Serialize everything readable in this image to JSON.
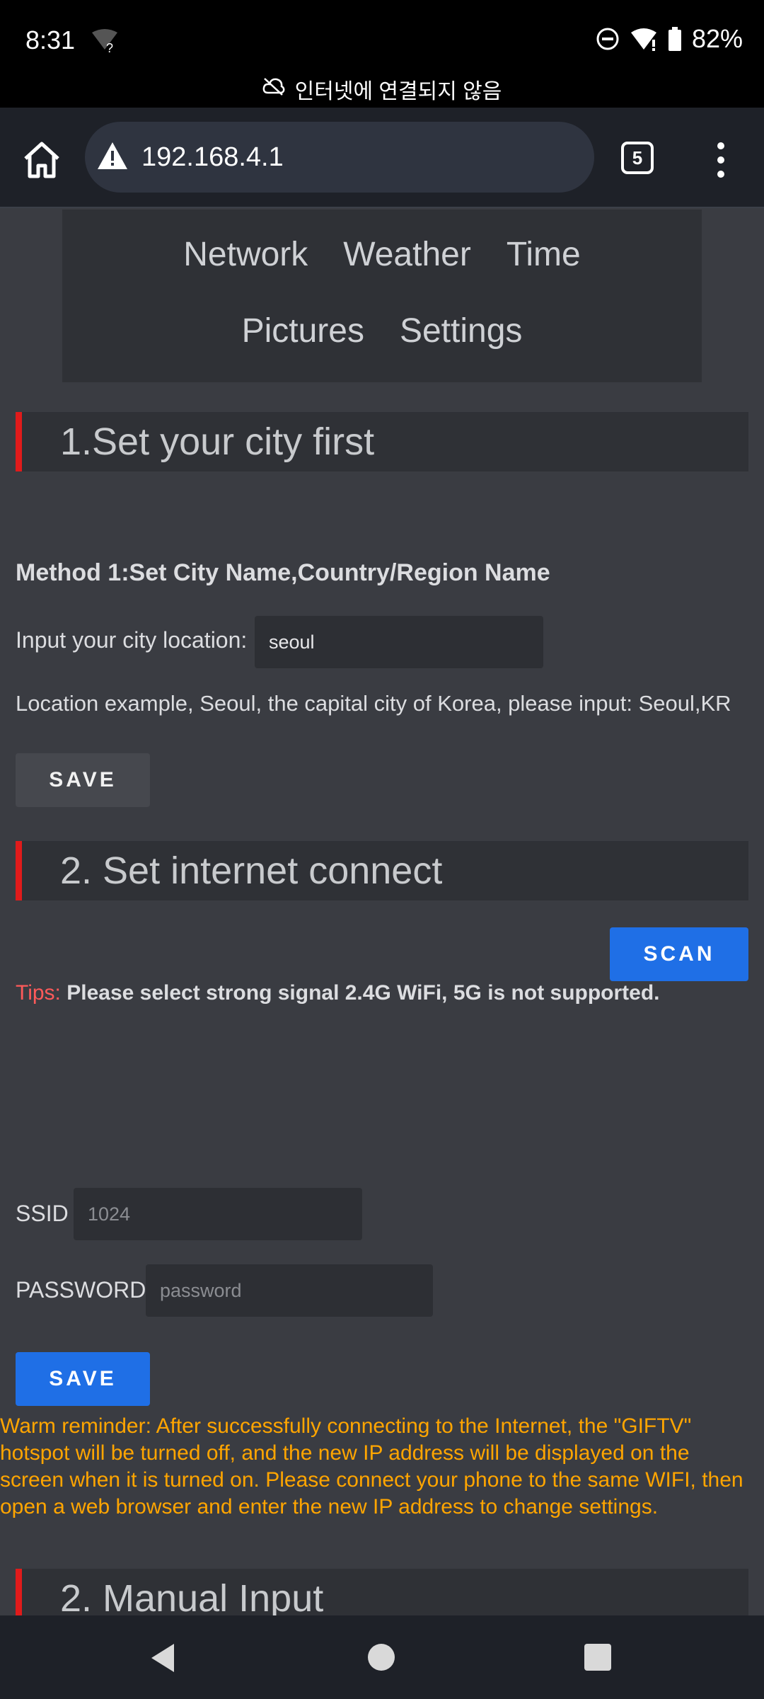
{
  "status_bar": {
    "time": "8:31",
    "battery": "82%",
    "offline_banner": "인터넷에 연결되지 않음"
  },
  "browser": {
    "url": "192.168.4.1",
    "tab_count": "5"
  },
  "nav": {
    "row1": [
      "Network",
      "Weather",
      "Time"
    ],
    "row2": [
      "Pictures",
      "Settings"
    ]
  },
  "section1": {
    "header": "1.Set your city first",
    "method_title": "Method 1:Set City Name,Country/Region Name",
    "city_label": "Input your city location:",
    "city_value": "seoul",
    "example": "Location example, Seoul, the capital city of Korea, please input: Seoul,KR",
    "save_label": "SAVE"
  },
  "section2": {
    "header": "2. Set internet connect",
    "scan_label": "SCAN",
    "tips_label": "Tips:",
    "tips_text": "Please select strong signal 2.4G WiFi, 5G is not supported.",
    "ssid_label": "SSID :",
    "ssid_placeholder": "1024",
    "password_label": "PASSWORD :",
    "password_placeholder": "password",
    "save_label": "SAVE",
    "warm_reminder": "Warm reminder: After successfully connecting to the Internet, the \"GIFTV\" hotspot will be turned off, and the new IP address will be displayed on the screen when it is turned on. Please connect your phone to the same WIFI, then open a web browser and enter the new IP address to change settings."
  },
  "section3": {
    "header": "2. Manual Input"
  },
  "colors": {
    "accent_red": "#e01b1b",
    "button_blue": "#1f6fe6",
    "warning_orange": "#ffa500",
    "tips_red": "#ff5a5a"
  }
}
